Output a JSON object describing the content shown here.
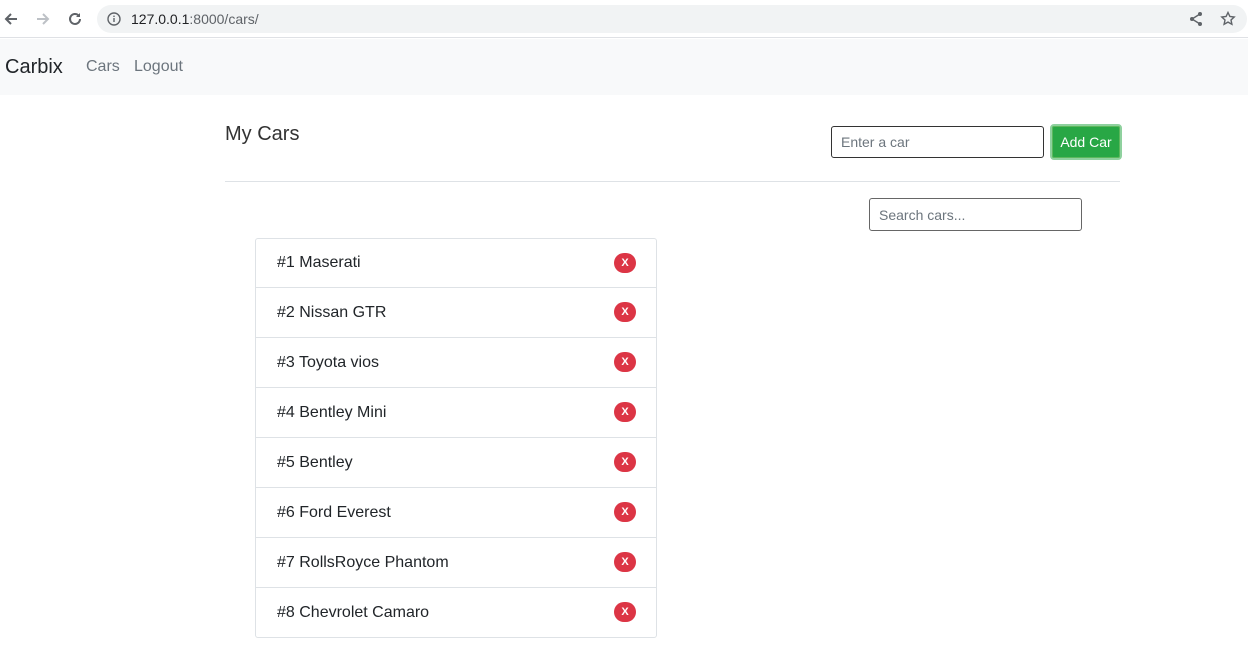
{
  "browser": {
    "url_host": "127.0.0.1",
    "url_rest": ":8000/cars/"
  },
  "navbar": {
    "brand": "Carbix",
    "links": [
      "Cars",
      "Logout"
    ]
  },
  "main": {
    "title": "My Cars",
    "car_input_placeholder": "Enter a car",
    "add_button_label": "Add Car",
    "search_placeholder": "Search cars..."
  },
  "cars": [
    {
      "label": "#1 Maserati",
      "delete_label": "X"
    },
    {
      "label": "#2 Nissan GTR",
      "delete_label": "X"
    },
    {
      "label": "#3 Toyota vios",
      "delete_label": "X"
    },
    {
      "label": "#4 Bentley Mini",
      "delete_label": "X"
    },
    {
      "label": "#5 Bentley",
      "delete_label": "X"
    },
    {
      "label": "#6 Ford Everest",
      "delete_label": "X"
    },
    {
      "label": "#7 RollsRoyce Phantom",
      "delete_label": "X"
    },
    {
      "label": "#8 Chevrolet Camaro",
      "delete_label": "X"
    }
  ],
  "colors": {
    "add_button": "#28a745",
    "delete_badge": "#dc3545",
    "navbar_bg": "#f8f9fa"
  }
}
